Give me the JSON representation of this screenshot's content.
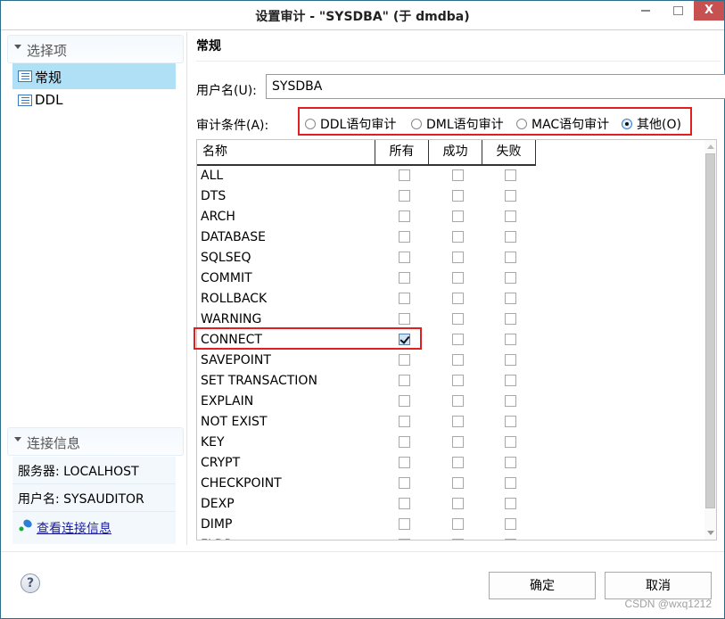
{
  "window": {
    "title": "设置审计 - \"SYSDBA\"  (于 dmdba)",
    "close_label": "X"
  },
  "left": {
    "options_section": "选择项",
    "nav_items": [
      {
        "label": "常规",
        "selected": true
      },
      {
        "label": "DDL",
        "selected": false
      }
    ],
    "connection_section": "连接信息",
    "server": "服务器: LOCALHOST",
    "username": "用户名: SYSAUDITOR",
    "view_connection_link": "查看连接信息"
  },
  "main": {
    "section_title": "常规",
    "username_label": "用户名(U):",
    "username_value": "SYSDBA",
    "condition_label": "审计条件(A):",
    "condition_options": [
      {
        "label": "DDL语句审计",
        "selected": false
      },
      {
        "label": "DML语句审计",
        "selected": false
      },
      {
        "label": "MAC语句审计",
        "selected": false
      },
      {
        "label": "其他(O)",
        "selected": true
      }
    ],
    "table": {
      "columns": [
        "名称",
        "所有",
        "成功",
        "失败"
      ],
      "rows": [
        {
          "name": "ALL",
          "all": false,
          "success": false,
          "fail": false
        },
        {
          "name": "DTS",
          "all": false,
          "success": false,
          "fail": false
        },
        {
          "name": "ARCH",
          "all": false,
          "success": false,
          "fail": false
        },
        {
          "name": "DATABASE",
          "all": false,
          "success": false,
          "fail": false
        },
        {
          "name": "SQLSEQ",
          "all": false,
          "success": false,
          "fail": false
        },
        {
          "name": "COMMIT",
          "all": false,
          "success": false,
          "fail": false
        },
        {
          "name": "ROLLBACK",
          "all": false,
          "success": false,
          "fail": false
        },
        {
          "name": "WARNING",
          "all": false,
          "success": false,
          "fail": false
        },
        {
          "name": "CONNECT",
          "all": true,
          "success": false,
          "fail": false
        },
        {
          "name": "SAVEPOINT",
          "all": false,
          "success": false,
          "fail": false
        },
        {
          "name": "SET TRANSACTION",
          "all": false,
          "success": false,
          "fail": false
        },
        {
          "name": "EXPLAIN",
          "all": false,
          "success": false,
          "fail": false
        },
        {
          "name": "NOT EXIST",
          "all": false,
          "success": false,
          "fail": false
        },
        {
          "name": "KEY",
          "all": false,
          "success": false,
          "fail": false
        },
        {
          "name": "CRYPT",
          "all": false,
          "success": false,
          "fail": false
        },
        {
          "name": "CHECKPOINT",
          "all": false,
          "success": false,
          "fail": false
        },
        {
          "name": "DEXP",
          "all": false,
          "success": false,
          "fail": false
        },
        {
          "name": "DIMP",
          "all": false,
          "success": false,
          "fail": false
        },
        {
          "name": "FLDR",
          "all": false,
          "success": false,
          "fail": false
        }
      ]
    }
  },
  "footer": {
    "help_label": "?",
    "ok_label": "确定",
    "cancel_label": "取消",
    "watermark": "CSDN @wxq1212"
  },
  "colors": {
    "highlight_border": "#e02020",
    "selected_nav": "#b0e0f6",
    "close_button": "#c75050"
  }
}
